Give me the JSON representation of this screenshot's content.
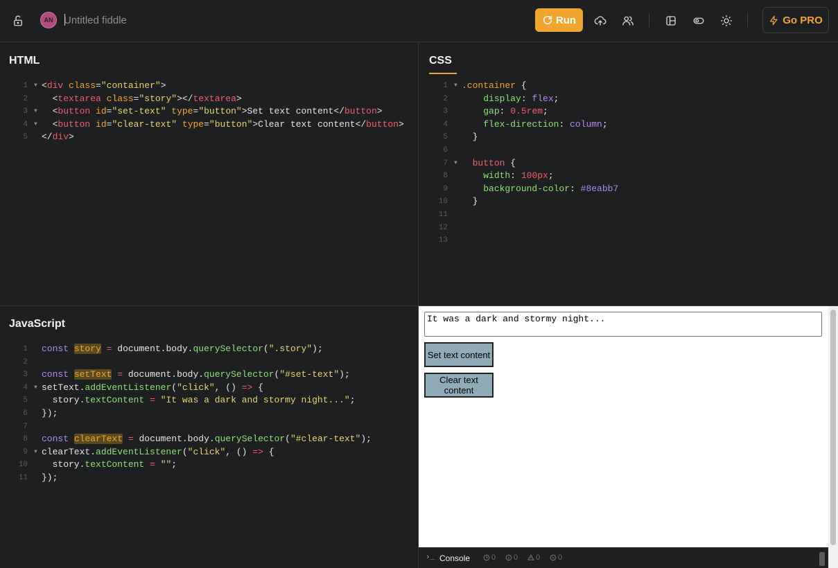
{
  "topbar": {
    "avatar_initials": "AN",
    "title_placeholder": "Untitled fiddle",
    "run_label": "Run",
    "pro_label": "Go PRO"
  },
  "panes": {
    "html_title": "HTML",
    "css_title": "CSS",
    "js_title": "JavaScript"
  },
  "html_code": {
    "line_numbers": [
      "1",
      "2",
      "3",
      "4",
      "5"
    ]
  },
  "css_code": {
    "line_numbers": [
      "1",
      "2",
      "3",
      "4",
      "5",
      "6",
      "7",
      "8",
      "9",
      "10",
      "11",
      "12",
      "13"
    ]
  },
  "js_code": {
    "line_numbers": [
      "1",
      "2",
      "3",
      "4",
      "5",
      "6",
      "7",
      "8",
      "9",
      "10",
      "11"
    ]
  },
  "preview": {
    "textarea_value": "It was a dark and stormy night...",
    "set_button": "Set text content",
    "clear_button": "Clear text content"
  },
  "console": {
    "prompt": "›_",
    "label": "Console",
    "counts": [
      "0",
      "0",
      "0",
      "0"
    ]
  },
  "colors": {
    "accent": "#f0a52e",
    "button_bg": "#8eabb7",
    "background": "#1e1f20"
  }
}
